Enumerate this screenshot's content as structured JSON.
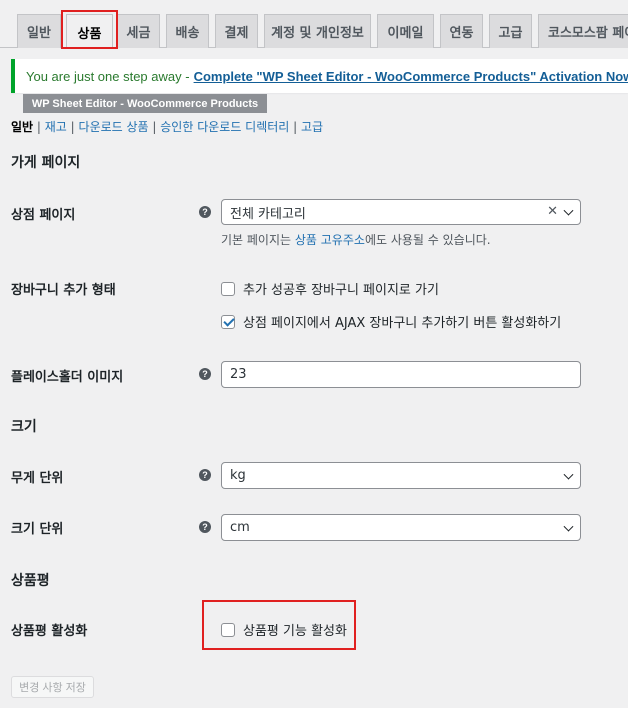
{
  "tabs": [
    {
      "label": "일반"
    },
    {
      "label": "상품"
    },
    {
      "label": "세금"
    },
    {
      "label": "배송"
    },
    {
      "label": "결제"
    },
    {
      "label": "계정 및 개인정보"
    },
    {
      "label": "이메일"
    },
    {
      "label": "연동"
    },
    {
      "label": "고급"
    },
    {
      "label": "코스모스팜 페이"
    }
  ],
  "active_tab": "상품",
  "notice": {
    "text": "You are just one step away - ",
    "link": "Complete \"WP Sheet Editor - WooCommerce Products\" Activation Now"
  },
  "plugin_badge": "WP Sheet Editor - WooCommerce Products",
  "subnav": {
    "current": "일반",
    "links": [
      "재고",
      "다운로드 상품",
      "승인한 다운로드 디렉터리",
      "고급"
    ],
    "sep": " | "
  },
  "sections": {
    "store_pages": "가게 페이지",
    "size": "크기",
    "reviews": "상품평"
  },
  "shop_page": {
    "label": "상점 페이지",
    "value": "전체 카테고리",
    "desc_pre": "기본 페이지는 ",
    "desc_link": "상품 고유주소",
    "desc_post": "에도 사용될 수 있습니다."
  },
  "add_to_cart": {
    "label": "장바구니 추가 형태",
    "option1": "추가 성공후 장바구니 페이지로 가기",
    "option1_checked": false,
    "option2": "상점 페이지에서 AJAX 장바구니 추가하기 버튼 활성화하기",
    "option2_checked": true
  },
  "placeholder_image": {
    "label": "플레이스홀더 이미지",
    "value": "23"
  },
  "weight_unit": {
    "label": "무게 단위",
    "value": "kg"
  },
  "dimension_unit": {
    "label": "크기 단위",
    "value": "cm"
  },
  "enable_reviews": {
    "label": "상품평 활성화",
    "option": "상품평 기능 활성화",
    "checked": false
  },
  "help_glyph": "?",
  "clear_glyph": "✕",
  "save_label": "변경 사항 저장",
  "colors": {
    "accent": "#2271b1",
    "notice_border": "#00a32a",
    "highlight": "#e02020"
  }
}
